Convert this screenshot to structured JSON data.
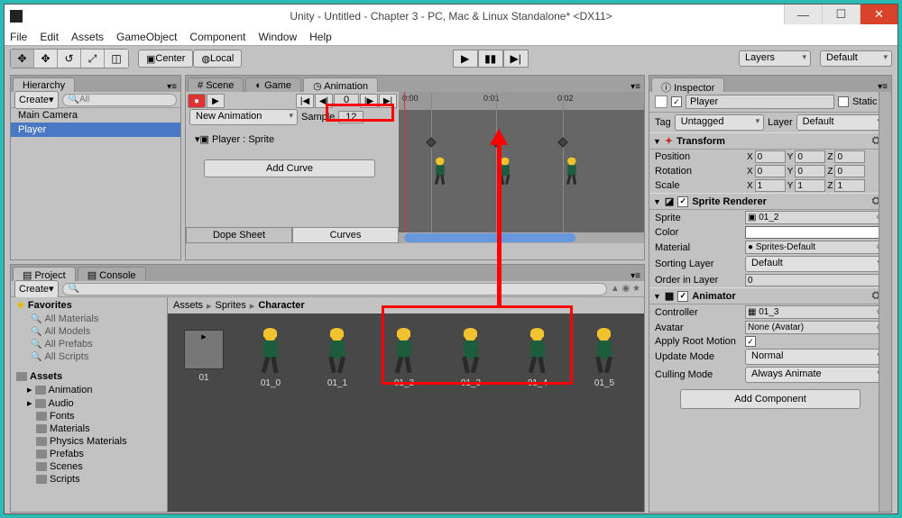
{
  "window": {
    "title": "Unity - Untitled - Chapter 3 - PC, Mac & Linux Standalone* <DX11>"
  },
  "menu": {
    "file": "File",
    "edit": "Edit",
    "assets": "Assets",
    "gameobject": "GameObject",
    "component": "Component",
    "window": "Window",
    "help": "Help"
  },
  "toolbar": {
    "center": "Center",
    "local": "Local",
    "layers": "Layers",
    "layout": "Default"
  },
  "hierarchy": {
    "title": "Hierarchy",
    "create": "Create",
    "search": "All",
    "items": [
      "Main Camera",
      "Player"
    ]
  },
  "tabs": {
    "scene": "Scene",
    "game": "Game",
    "animation": "Animation"
  },
  "animation": {
    "clip": "New Animation",
    "sample_label": "Sample",
    "sample": "12",
    "frame": "0",
    "property": "Player : Sprite",
    "add_curve": "Add Curve",
    "dope": "Dope Sheet",
    "curves": "Curves",
    "ticks": [
      "0:00",
      "0:01",
      "0:02"
    ]
  },
  "inspector": {
    "title": "Inspector",
    "name": "Player",
    "static": "Static",
    "tag_label": "Tag",
    "tag": "Untagged",
    "layer_label": "Layer",
    "layer": "Default",
    "transform": {
      "title": "Transform",
      "position": "Position",
      "rotation": "Rotation",
      "scale": "Scale",
      "px": "0",
      "py": "0",
      "pz": "0",
      "rx": "0",
      "ry": "0",
      "rz": "0",
      "sx": "1",
      "sy": "1",
      "sz": "1"
    },
    "sprite_renderer": {
      "title": "Sprite Renderer",
      "sprite_label": "Sprite",
      "sprite": "01_2",
      "color_label": "Color",
      "material_label": "Material",
      "material": "Sprites-Default",
      "sorting_label": "Sorting Layer",
      "sorting": "Default",
      "order_label": "Order in Layer",
      "order": "0"
    },
    "animator": {
      "title": "Animator",
      "controller_label": "Controller",
      "controller": "01_3",
      "avatar_label": "Avatar",
      "avatar": "None (Avatar)",
      "root_label": "Apply Root Motion",
      "update_label": "Update Mode",
      "update": "Normal",
      "culling_label": "Culling Mode",
      "culling": "Always Animate"
    },
    "add_component": "Add Component"
  },
  "project": {
    "title": "Project",
    "console": "Console",
    "create": "Create",
    "favorites": "Favorites",
    "fav_items": [
      "All Materials",
      "All Models",
      "All Prefabs",
      "All Scripts"
    ],
    "assets": "Assets",
    "folders": [
      "Animation",
      "Audio",
      "Fonts",
      "Materials",
      "Physics Materials",
      "Prefabs",
      "Scenes",
      "Scripts"
    ],
    "breadcrumb": {
      "a": "Assets",
      "b": "Sprites",
      "c": "Character"
    },
    "items": [
      "01",
      "01_0",
      "01_1",
      "01_2",
      "01_3",
      "01_4",
      "01_5"
    ]
  }
}
